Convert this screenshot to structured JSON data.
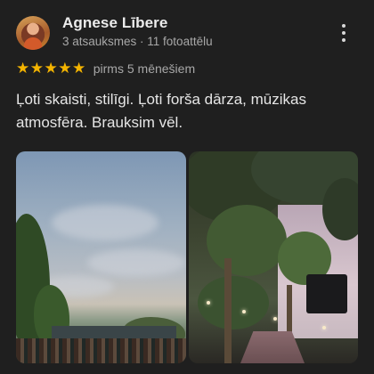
{
  "review": {
    "author": {
      "name": "Agnese Lībere",
      "meta": "3 atsauksmes · 11 fotoattēlu"
    },
    "rating": 5,
    "stars": [
      "★",
      "★",
      "★",
      "★",
      "★"
    ],
    "time_ago": "pirms 5 mēnešiem",
    "text": "Ļoti skaisti, stilīgi. Ļoti forša dārza, mūzikas atmosfēra. Brauksim vēl.",
    "photos": [
      {
        "name": "photo-sunset-sky-trees"
      },
      {
        "name": "photo-garden-trees-stage"
      }
    ]
  },
  "colors": {
    "background": "#1f1f1f",
    "star": "#f4b400",
    "primary_text": "#e6e6e6",
    "secondary_text": "#a8a8a8"
  },
  "icons": {
    "more": "more-vertical-icon",
    "star": "star-icon"
  }
}
